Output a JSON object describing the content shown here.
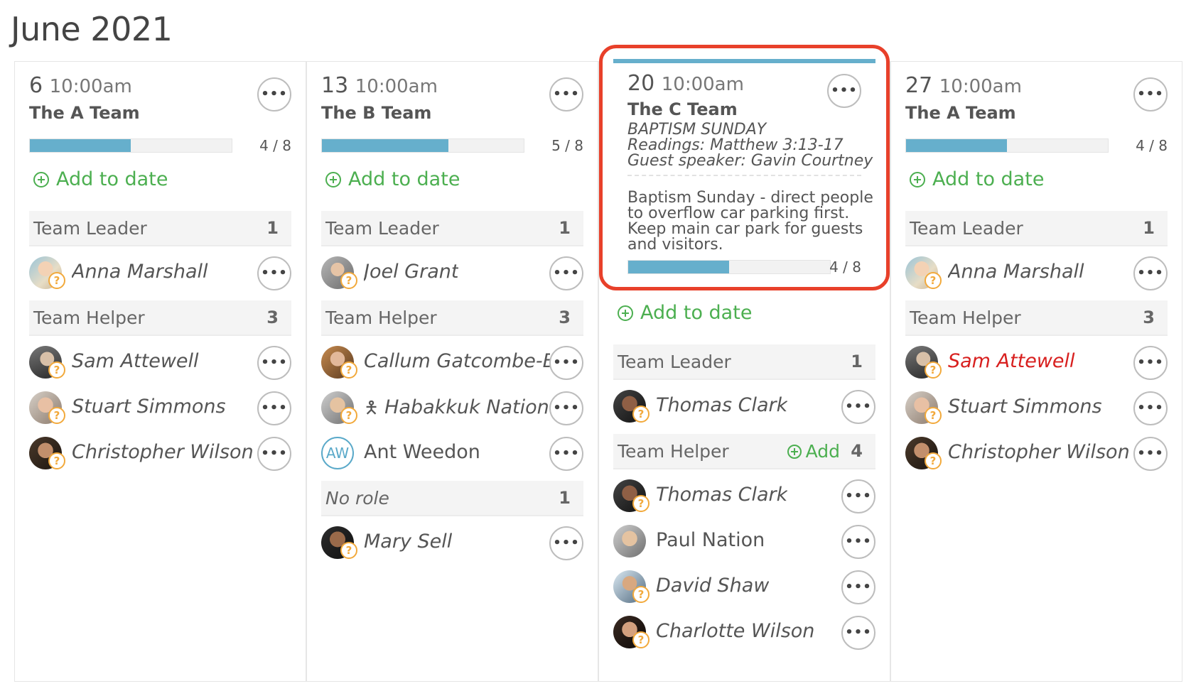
{
  "page": {
    "title": "June 2021"
  },
  "labels": {
    "add_to_date": "Add to date",
    "more": "•••",
    "add": "Add",
    "unknown_badge": "?"
  },
  "columns": [
    {
      "day": "6",
      "time": "10:00am",
      "team": "The A Team",
      "count": "4 / 8",
      "progress": 0.5,
      "roles": [
        {
          "name": "Team Leader",
          "count": "1",
          "people": [
            {
              "name": "Anna Marshall"
            }
          ]
        },
        {
          "name": "Team Helper",
          "count": "3",
          "people": [
            {
              "name": "Sam Attewell"
            },
            {
              "name": "Stuart Simmons"
            },
            {
              "name": "Christopher Wilson"
            }
          ]
        }
      ]
    },
    {
      "day": "13",
      "time": "10:00am",
      "team": "The B Team",
      "count": "5 / 8",
      "progress": 0.625,
      "roles": [
        {
          "name": "Team Leader",
          "count": "1",
          "people": [
            {
              "name": "Joel Grant"
            }
          ]
        },
        {
          "name": "Team Helper",
          "count": "3",
          "people": [
            {
              "name": "Callum Gatcombe-Batt"
            },
            {
              "name": "Habakkuk Nation"
            },
            {
              "name": "Ant Weedon",
              "initials": "AW"
            }
          ]
        },
        {
          "name": "No role",
          "count": "1",
          "people": [
            {
              "name": "Mary Sell"
            }
          ]
        }
      ]
    },
    {
      "day": "20",
      "time": "10:00am",
      "team": "The C Team",
      "count": "4 / 8",
      "progress": 0.5,
      "desc": [
        "BAPTISM SUNDAY",
        "Readings: Matthew 3:13-17",
        "Guest speaker: Gavin Courtney"
      ],
      "note": "Baptism Sunday - direct people to overflow car parking first. Keep main car park for guests and visitors.",
      "roles": [
        {
          "name": "Team Leader",
          "count": "1",
          "people": [
            {
              "name": "Thomas Clark"
            }
          ]
        },
        {
          "name": "Team Helper",
          "count": "4",
          "people": [
            {
              "name": "Thomas Clark"
            },
            {
              "name": "Paul Nation"
            },
            {
              "name": "David Shaw"
            },
            {
              "name": "Charlotte Wilson"
            }
          ]
        }
      ]
    },
    {
      "day": "27",
      "time": "10:00am",
      "team": "The A Team",
      "count": "4 / 8",
      "progress": 0.5,
      "roles": [
        {
          "name": "Team Leader",
          "count": "1",
          "people": [
            {
              "name": "Anna Marshall"
            }
          ]
        },
        {
          "name": "Team Helper",
          "count": "3",
          "people": [
            {
              "name": "Sam Attewell"
            },
            {
              "name": "Stuart Simmons"
            },
            {
              "name": "Christopher Wilson"
            }
          ]
        }
      ]
    }
  ],
  "colors": {
    "accent_blue": "#66afcc",
    "green": "#4caf50",
    "highlight_red": "#e8402a",
    "warning_orange": "#f2a93b",
    "conflict_red": "#d8201f"
  }
}
